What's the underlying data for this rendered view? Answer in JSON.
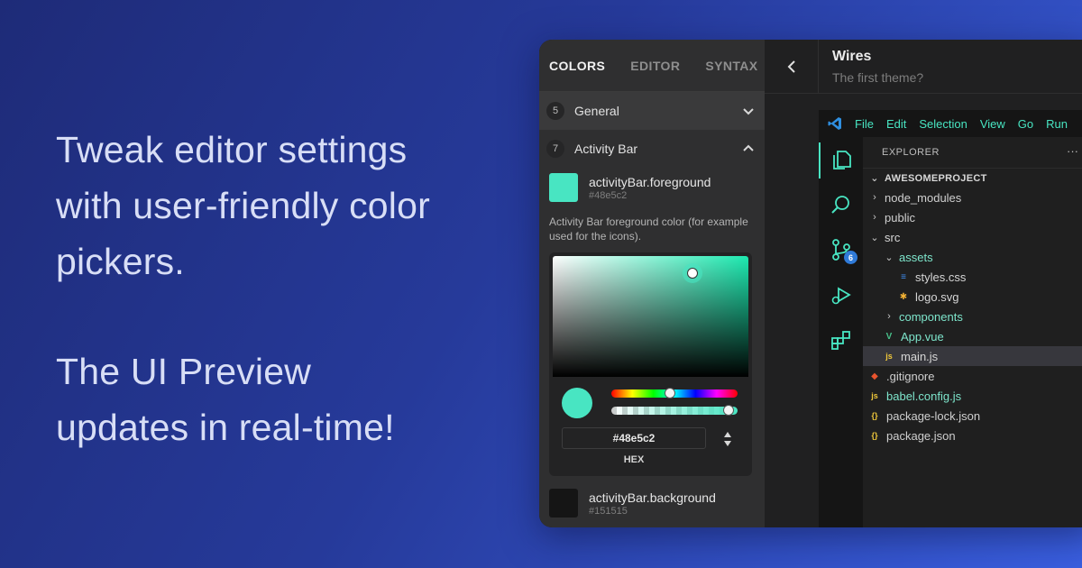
{
  "tagline": {
    "line1": "Tweak editor settings",
    "line2": "with user-friendly color",
    "line3": "pickers.",
    "line4": "The UI Preview",
    "line5": "updates in real-time!"
  },
  "panel": {
    "tabs": [
      {
        "label": "COLORS",
        "active": true
      },
      {
        "label": "EDITOR",
        "active": false
      },
      {
        "label": "SYNTAX",
        "active": false
      }
    ],
    "sections": [
      {
        "count": "5",
        "title": "General",
        "expanded": false
      },
      {
        "count": "7",
        "title": "Activity Bar",
        "expanded": true
      }
    ],
    "items": [
      {
        "name": "activityBar.foreground",
        "hex": "#48e5c2",
        "color": "#48e5c2"
      },
      {
        "name": "activityBar.background",
        "hex": "#151515",
        "color": "#151515"
      }
    ],
    "description": "Activity Bar foreground color (for example used for the icons).",
    "picker": {
      "value": "#48e5c2",
      "mode_label": "HEX",
      "hue_fraction": 0.46,
      "alpha_fraction": 0.97
    }
  },
  "preview": {
    "theme_name": "Wires",
    "theme_description": "The first theme?",
    "accent": "#48e5c2",
    "menu": [
      "File",
      "Edit",
      "Selection",
      "View",
      "Go",
      "Run"
    ],
    "scm_badge": "6",
    "explorer": {
      "header": "EXPLORER",
      "more": "···",
      "project": "AWESOMEPROJECT",
      "tree": [
        {
          "label": "node_modules",
          "depth": 1,
          "type": "folder",
          "open": false
        },
        {
          "label": "public",
          "depth": 1,
          "type": "folder",
          "open": false
        },
        {
          "label": "src",
          "depth": 1,
          "type": "folder",
          "open": true
        },
        {
          "label": "assets",
          "depth": 2,
          "type": "folder",
          "open": true
        },
        {
          "label": "styles.css",
          "depth": 3,
          "type": "css"
        },
        {
          "label": "logo.svg",
          "depth": 3,
          "type": "svg"
        },
        {
          "label": "components",
          "depth": 2,
          "type": "folder",
          "open": false
        },
        {
          "label": "App.vue",
          "depth": 2,
          "type": "vue"
        },
        {
          "label": "main.js",
          "depth": 2,
          "type": "js",
          "selected": true
        },
        {
          "label": ".gitignore",
          "depth": 1,
          "type": "git"
        },
        {
          "label": "babel.config.js",
          "depth": 1,
          "type": "js"
        },
        {
          "label": "package-lock.json",
          "depth": 1,
          "type": "json"
        },
        {
          "label": "package.json",
          "depth": 1,
          "type": "json"
        }
      ]
    }
  }
}
